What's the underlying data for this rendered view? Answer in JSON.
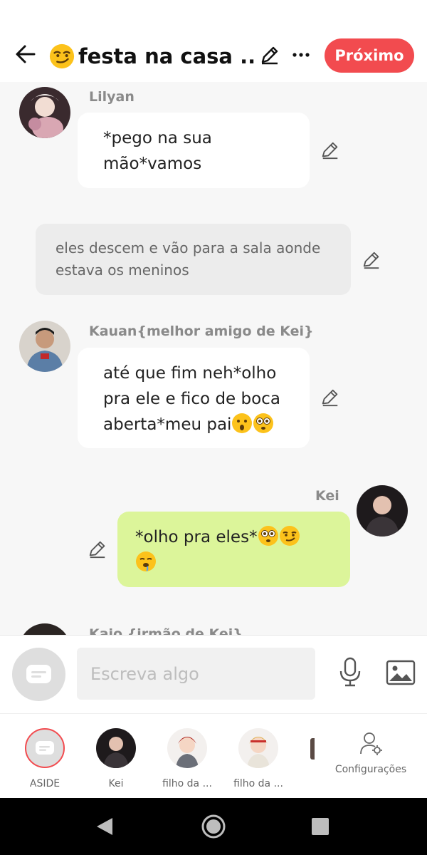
{
  "header": {
    "title": "festa na casa ...",
    "title_emoji": "smirking-face-emoji",
    "next_label": "Próximo",
    "accent_color": "#f24b4f"
  },
  "messages": [
    {
      "sender": "Lilyan",
      "lines": [
        "*pego na sua",
        "mão*vamos"
      ]
    },
    {
      "narration_lines": [
        "eles descem e vão para a sala aonde",
        "estava os meninos"
      ]
    },
    {
      "sender": "Kauan{melhor amigo de Kei}",
      "lines": [
        "até que fim neh*olho",
        "pra ele e fico de boca",
        "aberta*meu pai"
      ]
    },
    {
      "sender": "Kei",
      "lines": [
        "*olho pra eles*"
      ]
    },
    {
      "sender": "Kaio {irmão de Kei}"
    }
  ],
  "composer": {
    "placeholder": "Escreva algo"
  },
  "characters": [
    {
      "label": "ASIDE"
    },
    {
      "label": "Kei"
    },
    {
      "label": "filho da ..."
    },
    {
      "label": "filho da ..."
    }
  ],
  "settings_label": "Configurações",
  "colors": {
    "my_bubble": "#dcf59a",
    "other_bubble": "#ffffff",
    "narration_bubble": "#ececec"
  }
}
